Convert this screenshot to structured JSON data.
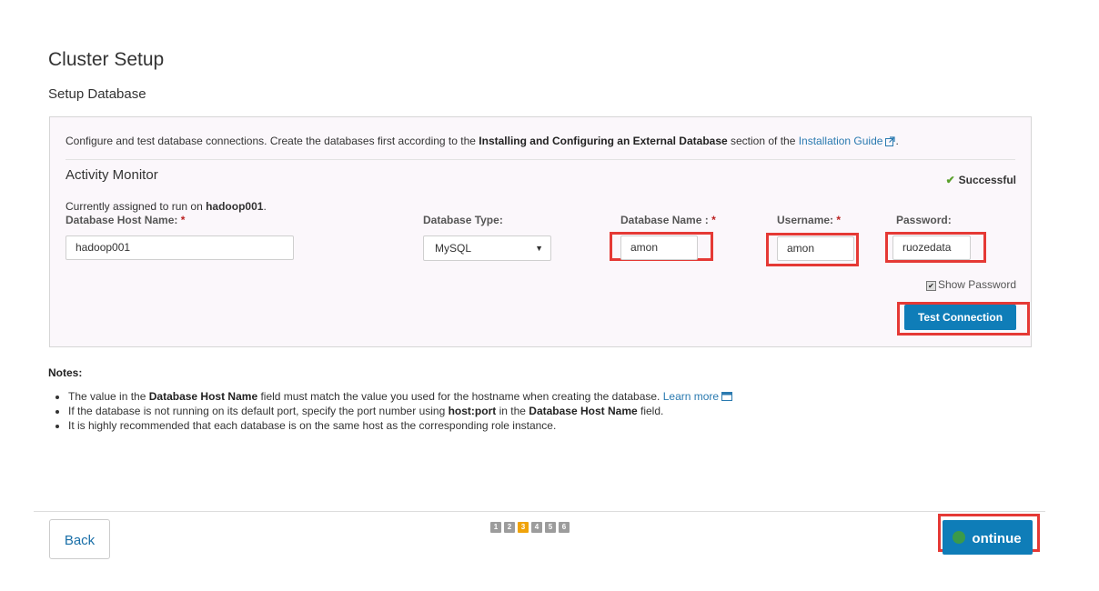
{
  "page": {
    "title": "Cluster Setup",
    "subtitle": "Setup Database"
  },
  "panel": {
    "intro_prefix": "Configure and test database connections. Create the databases first according to the ",
    "intro_bold": "Installing and Configuring an External Database",
    "intro_middle": " section of the ",
    "intro_link": "Installation Guide",
    "intro_suffix": ".",
    "section_title": "Activity Monitor",
    "status": "Successful",
    "assigned_prefix": "Currently assigned to run on ",
    "assigned_host": "hadoop001",
    "assigned_suffix": ".",
    "fields": {
      "host_label": "Database Host Name:",
      "host_value": "hadoop001",
      "type_label": "Database Type:",
      "type_value": "MySQL",
      "dbname_label": "Database Name :",
      "dbname_value": "amon",
      "username_label": "Username:",
      "username_value": "amon",
      "password_label": "Password:",
      "password_value": "ruozedata",
      "required_mark": "*"
    },
    "show_password_label": "Show Password",
    "show_password_checked": true,
    "test_button": "Test Connection"
  },
  "notes": {
    "title": "Notes:",
    "n1_a": "The value in the ",
    "n1_b": "Database Host Name",
    "n1_c": " field must match the value you used for the hostname when creating the database. ",
    "n1_link": "Learn more",
    "n2_a": "If the database is not running on its default port, specify the port number using ",
    "n2_b": "host:port",
    "n2_c": " in the ",
    "n2_d": "Database Host Name",
    "n2_e": " field.",
    "n3": "It is highly recommended that each database is on the same host as the corresponding role instance."
  },
  "footer": {
    "back": "Back",
    "continue": "ontinue",
    "steps": [
      "1",
      "2",
      "3",
      "4",
      "5",
      "6"
    ],
    "active_step": "3"
  },
  "colors": {
    "accent": "#0f7db8",
    "highlight": "#e53935",
    "active_step": "#f0a30a",
    "success": "#5aa02c"
  }
}
